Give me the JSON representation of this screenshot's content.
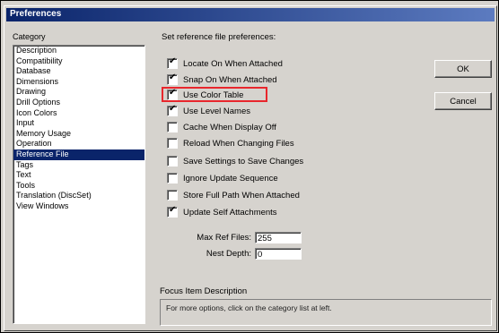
{
  "window": {
    "title": "Preferences"
  },
  "categories": {
    "label": "Category",
    "items": [
      "Description",
      "Compatibility",
      "Database",
      "Dimensions",
      "Drawing",
      "Drill Options",
      "Icon Colors",
      "Input",
      "Memory Usage",
      "Operation",
      "Reference File",
      "Tags",
      "Text",
      "Tools",
      "Translation (DiscSet)",
      "View Windows"
    ],
    "selected": "Reference File"
  },
  "panel": {
    "header": "Set reference file preferences:",
    "options": [
      {
        "label": "Locate On When Attached",
        "checked": true
      },
      {
        "label": "Snap On When Attached",
        "checked": true
      },
      {
        "label": "Use Color Table",
        "checked": true
      },
      {
        "label": "Use Level Names",
        "checked": true
      },
      {
        "label": "Cache When Display Off",
        "checked": false
      },
      {
        "label": "Reload When Changing Files",
        "checked": false
      },
      {
        "label": "Save Settings to Save Changes",
        "checked": false
      },
      {
        "label": "Ignore Update Sequence",
        "checked": false
      },
      {
        "label": "Store Full Path When Attached",
        "checked": false
      },
      {
        "label": "Update Self Attachments",
        "checked": true
      }
    ],
    "max_ref_files": {
      "label": "Max Ref Files:",
      "value": "255"
    },
    "nest_depth": {
      "label": "Nest Depth:",
      "value": "0"
    },
    "highlighted_option": "Use Color Table"
  },
  "buttons": {
    "ok": "OK",
    "cancel": "Cancel"
  },
  "focus": {
    "label": "Focus Item Description",
    "text": "For more options, click on the category list at left."
  },
  "colors": {
    "titlebar": "#0a246a",
    "selection": "#0a246a",
    "highlight": "#e8262c"
  }
}
